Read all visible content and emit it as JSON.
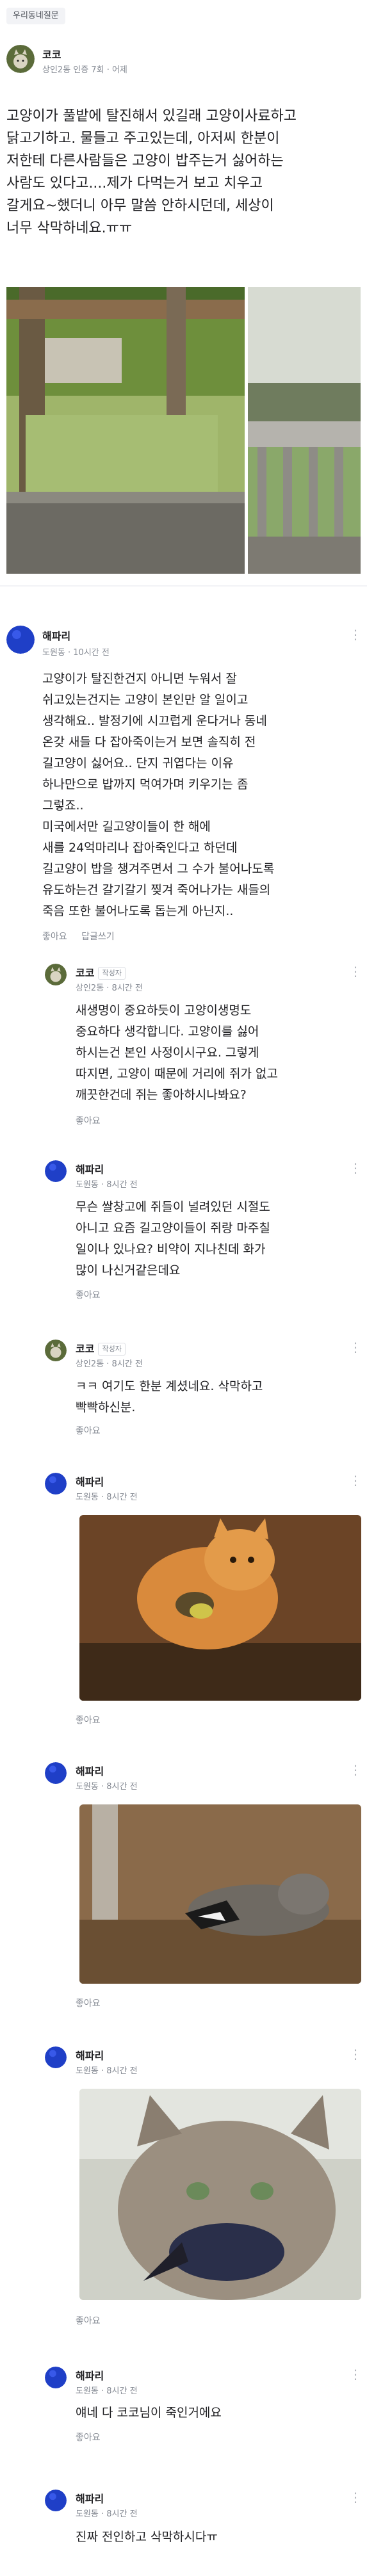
{
  "category_tag": "우리동네질문",
  "post": {
    "author": "코코",
    "meta": "상인2동 인증 7회 · 어제",
    "body_lines": [
      "고양이가 풀밭에 탈진해서 있길래 고양이사료하고",
      "닭고기하고. 물들고 주고있는데, 아저씨 한분이",
      "저한테 다른사람들은 고양이 밥주는거 싫어하는",
      "사람도 있다고....제가 다먹는거 보고 치우고",
      "갈게요~했더니 아무 말씀 안하시던데, 세상이",
      "너무 삭막하네요.ㅠㅠ"
    ]
  },
  "comments": [
    {
      "author": "해파리",
      "meta": "도원동 · 10시간 전",
      "lines": [
        "고양이가 탈진한건지 아니면 누워서 잘",
        "쉬고있는건지는 고양이 본인만 알 일이고",
        "생각해요.. 발정기에 시끄럽게 운다거나 동네",
        "온갖 새들 다 잡아죽이는거 보면 솔직히 전",
        "길고양이 싫어요.. 단지 귀엽다는 이유",
        "하나만으로 밥까지 먹여가며 키우기는 좀",
        "그렇죠..",
        "미국에서만 길고양이들이 한 해에",
        "새를 24억마리나 잡아죽인다고 하던데",
        "길고양이 밥을 챙겨주면서 그 수가 불어나도록",
        "유도하는건 갈기갈기 찢겨 죽어나가는 새들의",
        "죽음 또한 불어나도록 돕는게 아닌지.."
      ],
      "like": "좋아요",
      "reply": "답글쓰기"
    }
  ],
  "replies": [
    {
      "author": "코코",
      "badge": "작성자",
      "meta": "상인2동 · 8시간 전",
      "lines": [
        "새생명이 중요하듯이 고양이생명도",
        "중요하다 생각합니다.   고양이를 싫어",
        "하시는건 본인 사정이시구요. 그렇게",
        "따지면, 고양이 때문에 거리에 쥐가 없고",
        "깨끗한건데 쥐는 좋아하시나봐요?"
      ],
      "like": "좋아요"
    },
    {
      "author": "해파리",
      "meta": "도원동 · 8시간 전",
      "lines": [
        "무슨 쌀창고에 쥐들이 널려있던 시절도",
        "아니고 요즘 길고양이들이 쥐랑 마주칠",
        "일이나 있나요? 비약이 지나친데 화가",
        "많이 나신거같은데요"
      ],
      "like": "좋아요"
    },
    {
      "author": "코코",
      "badge": "작성자",
      "meta": "상인2동 · 8시간 전",
      "lines": [
        "ㅋㅋ 여기도 한분 계셨네요. 삭막하고",
        "빡빡하신분."
      ],
      "like": "좋아요"
    },
    {
      "author": "해파리",
      "meta": "도원동 · 8시간 전",
      "lines": [],
      "like": "좋아요"
    },
    {
      "author": "해파리",
      "meta": "도원동 · 8시간 전",
      "lines": [],
      "like": "좋아요"
    },
    {
      "author": "해파리",
      "meta": "도원동 · 8시간 전",
      "lines": [],
      "like": "좋아요"
    },
    {
      "author": "해파리",
      "meta": "도원동 · 8시간 전",
      "lines": [
        "얘네 다 코코님이 죽인거에요"
      ],
      "like": "좋아요"
    },
    {
      "author": "해파리",
      "meta": "도원동 · 8시간 전",
      "lines": [
        "진짜 전인하고 삭막하시다ㅠ"
      ],
      "like": ""
    }
  ],
  "icons": {
    "kebab": "more-vertical-icon",
    "avatar_post": "cat-avatar",
    "avatar_user": "blue-circle-avatar"
  },
  "colors": {
    "meta_gray": "#868b94",
    "divider": "#f2f3f6",
    "avatar_blue": "#1f3fc7"
  }
}
